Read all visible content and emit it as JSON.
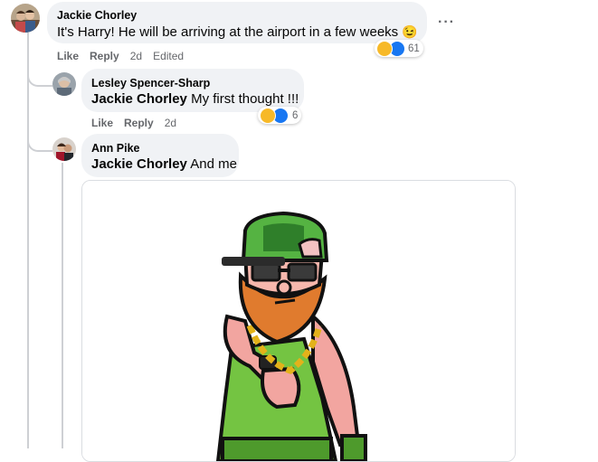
{
  "comments": [
    {
      "author": "Jackie Chorley",
      "text": "It's Harry! He will be arriving at the airport in a few weeks",
      "text_emoji": "😉",
      "actions": {
        "like": "Like",
        "reply": "Reply",
        "time": "2d",
        "edited": "Edited"
      },
      "reactions": {
        "count": "61",
        "icons": [
          "laugh-emoji",
          "like"
        ]
      },
      "menu": "···"
    },
    {
      "author": "Lesley Spencer-Sharp",
      "mention": "Jackie Chorley",
      "text": "My first thought !!!",
      "actions": {
        "like": "Like",
        "reply": "Reply",
        "time": "2d"
      },
      "reactions": {
        "count": "6",
        "icons": [
          "laugh-emoji",
          "like"
        ]
      }
    },
    {
      "author": "Ann Pike",
      "mention": "Jackie Chorley",
      "text": "And me"
    }
  ],
  "colors": {
    "accent": "#1877f2",
    "bubble": "#f0f2f5",
    "secondary_text": "#65676b"
  }
}
